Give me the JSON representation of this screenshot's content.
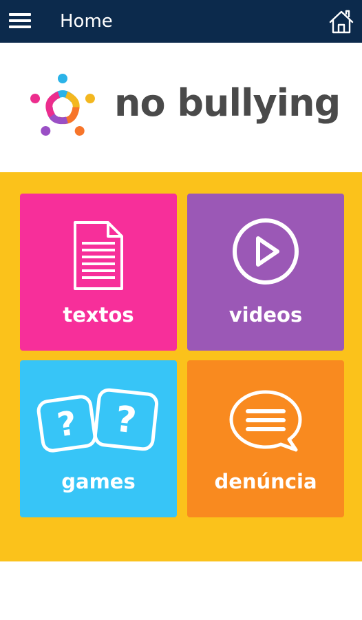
{
  "app_bar": {
    "title": "Home",
    "menu_icon": "hamburger-menu-icon",
    "home_icon": "home-icon",
    "background_color": "#0c2a4c"
  },
  "brand": {
    "name": "no bullying",
    "logo_icon": "people-star-logo"
  },
  "grid": {
    "background_color": "#fbc21b",
    "tiles": [
      {
        "label": "textos",
        "icon": "document-icon",
        "color": "#f72f9a"
      },
      {
        "label": "videos",
        "icon": "play-circle-icon",
        "color": "#9b58b6"
      },
      {
        "label": "games",
        "icon": "question-dice-icon",
        "color": "#37c5f7"
      },
      {
        "label": "denúncia",
        "icon": "speech-bubble-icon",
        "color": "#f98a1f"
      }
    ]
  }
}
